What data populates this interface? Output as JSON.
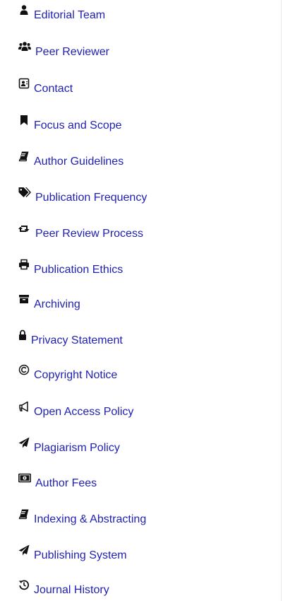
{
  "menu": {
    "items": [
      {
        "label": "Editorial Team",
        "icon": "user-icon"
      },
      {
        "label": "Peer Reviewer",
        "icon": "users-icon"
      },
      {
        "label": "Contact",
        "icon": "contact-card-icon"
      },
      {
        "label": "Focus and Scope",
        "icon": "bookmark-icon"
      },
      {
        "label": "Author Guidelines",
        "icon": "book-icon"
      },
      {
        "label": "Publication Frequency",
        "icon": "tags-icon"
      },
      {
        "label": "Peer Review Process",
        "icon": "retweet-icon"
      },
      {
        "label": "Publication Ethics",
        "icon": "print-icon"
      },
      {
        "label": "Archiving",
        "icon": "archive-icon"
      },
      {
        "label": "Privacy Statement",
        "icon": "lock-icon"
      },
      {
        "label": "Copyright Notice",
        "icon": "copyright-icon"
      },
      {
        "label": "Open Access Policy",
        "icon": "bullhorn-icon"
      },
      {
        "label": "Plagiarism Policy",
        "icon": "paper-plane-icon"
      },
      {
        "label": "Author Fees",
        "icon": "money-bill-icon"
      },
      {
        "label": "Indexing & Abstracting",
        "icon": "book-icon"
      },
      {
        "label": "Publishing System",
        "icon": "paper-plane-icon"
      },
      {
        "label": "Journal History",
        "icon": "history-icon"
      }
    ]
  },
  "colors": {
    "link": "#1f1fb3",
    "icon": "#111111",
    "border": "#e6e6e6"
  }
}
